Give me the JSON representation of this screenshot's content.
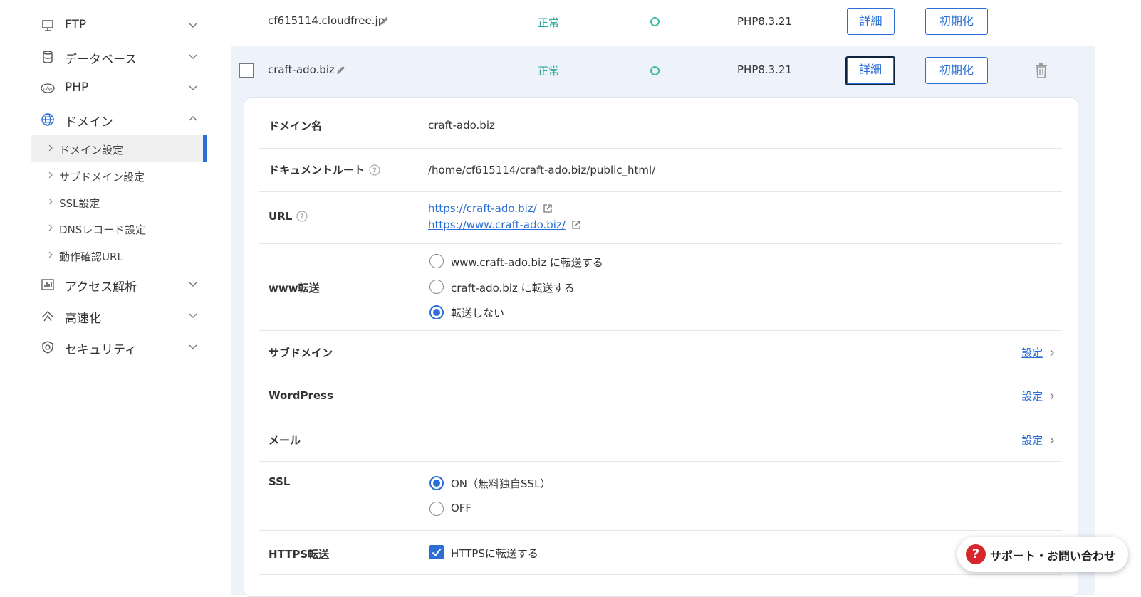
{
  "sidebar": {
    "items": [
      {
        "label": "FTP",
        "icon": "monitor-icon"
      },
      {
        "label": "データベース",
        "icon": "database-icon"
      },
      {
        "label": "PHP",
        "icon": "php-icon"
      },
      {
        "label": "ドメイン",
        "icon": "globe-icon"
      },
      {
        "label": "アクセス解析",
        "icon": "bar-chart-icon"
      },
      {
        "label": "高速化",
        "icon": "speed-icon"
      },
      {
        "label": "セキュリティ",
        "icon": "shield-icon"
      }
    ],
    "subitems": [
      {
        "label": "ドメイン設定",
        "active": true
      },
      {
        "label": "サブドメイン設定"
      },
      {
        "label": "SSL設定"
      },
      {
        "label": "DNSレコード設定"
      },
      {
        "label": "動作確認URL"
      }
    ]
  },
  "rows": [
    {
      "domain": "cf615114.cloudfree.jp",
      "status": "正常",
      "php": "PHP8.3.21",
      "detail_btn": "詳細",
      "reset_btn": "初期化"
    },
    {
      "domain": "craft-ado.biz",
      "status": "正常",
      "php": "PHP8.3.21",
      "detail_btn": "詳細",
      "reset_btn": "初期化"
    }
  ],
  "detail": {
    "domain_label": "ドメイン名",
    "domain_value": "craft-ado.biz",
    "docroot_label": "ドキュメントルート",
    "docroot_value": "/home/cf615114/craft-ado.biz/public_html/",
    "url_label": "URL",
    "url1": "https://craft-ado.biz/",
    "url2": "https://www.craft-ado.biz/",
    "www_label": "www転送",
    "www_options": [
      "www.craft-ado.biz に転送する",
      "craft-ado.biz に転送する",
      "転送しない"
    ],
    "www_selected": 2,
    "subdomain_label": "サブドメイン",
    "wordpress_label": "WordPress",
    "mail_label": "メール",
    "setting_link": "設定",
    "ssl_label": "SSL",
    "ssl_options": [
      "ON（無料独自SSL）",
      "OFF"
    ],
    "ssl_selected": 0,
    "https_label": "HTTPS転送",
    "https_checkbox": "HTTPSに転送する"
  },
  "support": {
    "label": "サポート・お問い合わせ",
    "icon": "question-icon"
  },
  "colors": {
    "accent": "#2b6fd6",
    "status_ok": "#24a89a",
    "support_red": "#d8262e"
  }
}
